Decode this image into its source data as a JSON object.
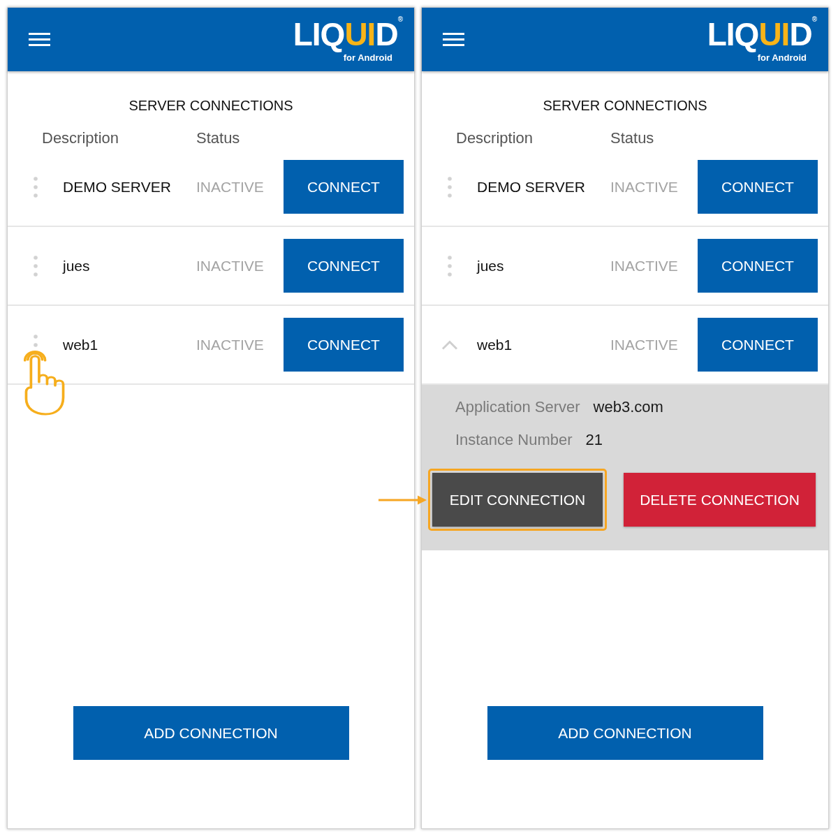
{
  "screens": [
    {
      "header": {
        "logo_parts": [
          {
            "text": "LIQ",
            "accent": false
          },
          {
            "text": "UI",
            "accent": true
          },
          {
            "text": "D",
            "accent": false
          }
        ],
        "logo_mark": "®",
        "logo_subtitle": "for Android"
      },
      "title": "SERVER CONNECTIONS",
      "columns": [
        "Description",
        "Status"
      ],
      "connections": [
        {
          "name": "DEMO SERVER",
          "status": "INACTIVE",
          "action": "CONNECT",
          "expanded": false,
          "tapped": false
        },
        {
          "name": "jues",
          "status": "INACTIVE",
          "action": "CONNECT",
          "expanded": false,
          "tapped": false
        },
        {
          "name": "web1",
          "status": "INACTIVE",
          "action": "CONNECT",
          "expanded": false,
          "tapped": true
        }
      ],
      "add_button": "ADD CONNECTION"
    },
    {
      "header": {
        "logo_parts": [
          {
            "text": "LIQ",
            "accent": false
          },
          {
            "text": "UI",
            "accent": true
          },
          {
            "text": "D",
            "accent": false
          }
        ],
        "logo_mark": "®",
        "logo_subtitle": "for Android"
      },
      "title": "SERVER CONNECTIONS",
      "columns": [
        "Description",
        "Status"
      ],
      "connections": [
        {
          "name": "DEMO SERVER",
          "status": "INACTIVE",
          "action": "CONNECT",
          "expanded": false,
          "tapped": false
        },
        {
          "name": "jues",
          "status": "INACTIVE",
          "action": "CONNECT",
          "expanded": false,
          "tapped": false
        },
        {
          "name": "web1",
          "status": "INACTIVE",
          "action": "CONNECT",
          "expanded": true,
          "tapped": false,
          "details": {
            "fields": [
              {
                "label": "Application Server",
                "value": "web3.com"
              },
              {
                "label": "Instance Number",
                "value": "21"
              }
            ],
            "actions": [
              {
                "label": "EDIT CONNECTION",
                "kind": "edit",
                "highlighted": true
              },
              {
                "label": "DELETE CONNECTION",
                "kind": "delete",
                "highlighted": false
              }
            ]
          }
        }
      ],
      "add_button": "ADD CONNECTION"
    }
  ]
}
